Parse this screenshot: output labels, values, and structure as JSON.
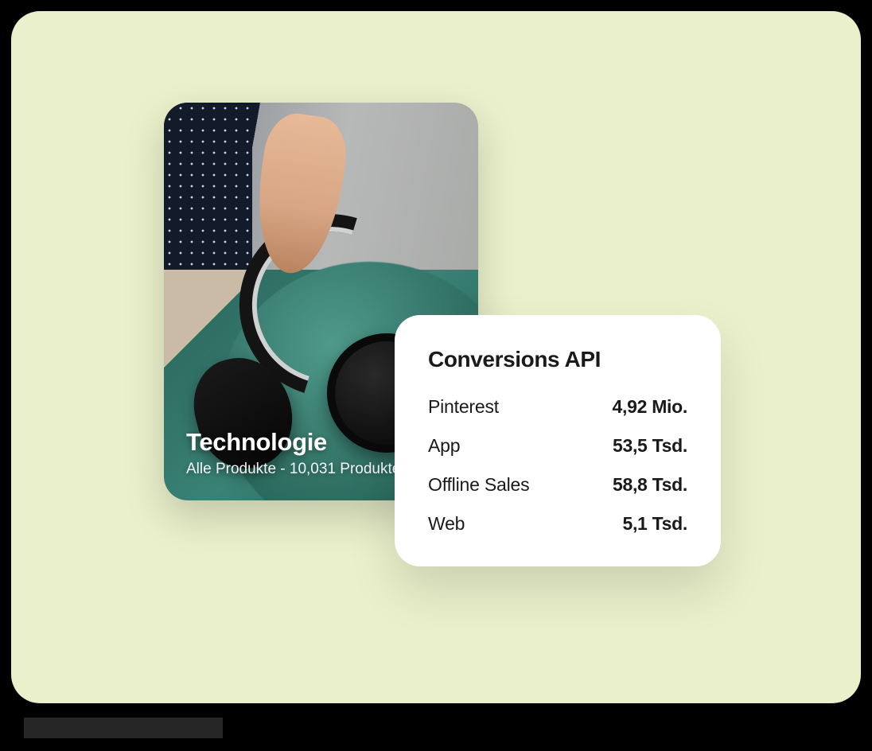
{
  "canvas": {
    "bg": "#EAF0CB"
  },
  "product_card": {
    "title": "Technologie",
    "subtitle": "Alle Produkte - 10,031 Produkte"
  },
  "stats_card": {
    "title": "Conversions API",
    "rows": [
      {
        "label": "Pinterest",
        "value": "4,92 Mio."
      },
      {
        "label": "App",
        "value": "53,5 Tsd."
      },
      {
        "label": "Offline Sales",
        "value": "58,8 Tsd."
      },
      {
        "label": "Web",
        "value": "5,1 Tsd."
      }
    ]
  }
}
